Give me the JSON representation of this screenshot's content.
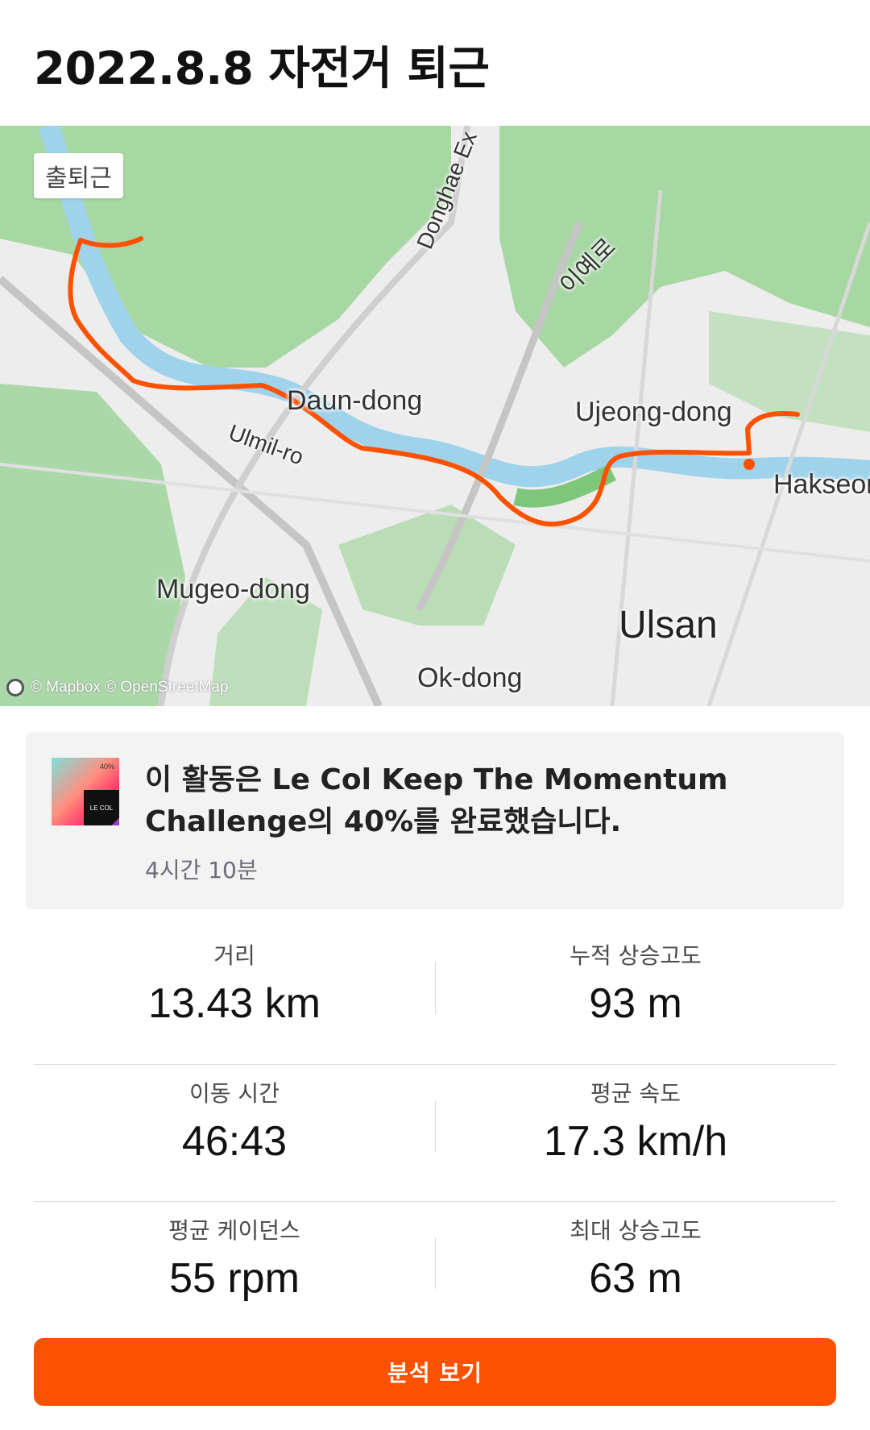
{
  "header": {
    "title": "2022.8.8 자전거 퇴근"
  },
  "map": {
    "tag": "출퇴근",
    "labels": {
      "daun": "Daun-dong",
      "ujeong": "Ujeong-dong",
      "mugeo": "Mugeo-dong",
      "ulsan": "Ulsan",
      "ok": "Ok-dong",
      "hakseong": "Hakseor",
      "ulmil": "Ulmil-ro",
      "donghae": "Donghae Ex",
      "iye": "이예로"
    },
    "attribution": "© Mapbox © OpenStreetMap",
    "route_color": "#fc5200"
  },
  "challenge": {
    "text": "이 활동은 Le Col Keep The Momentum Challenge의 40%를 완료했습니다.",
    "time": "4시간 10분",
    "badge_pct": "40%",
    "badge_brand": "LE COL"
  },
  "stats": {
    "distance": {
      "label": "거리",
      "value": "13.43 km"
    },
    "elevation_gain": {
      "label": "누적 상승고도",
      "value": "93 m"
    },
    "moving_time": {
      "label": "이동 시간",
      "value": "46:43"
    },
    "avg_speed": {
      "label": "평균 속도",
      "value": "17.3 km/h"
    },
    "avg_cadence": {
      "label": "평균 케이던스",
      "value": "55 rpm"
    },
    "max_elevation": {
      "label": "최대 상승고도",
      "value": "63 m"
    }
  },
  "actions": {
    "analyze_label": "분석 보기"
  }
}
